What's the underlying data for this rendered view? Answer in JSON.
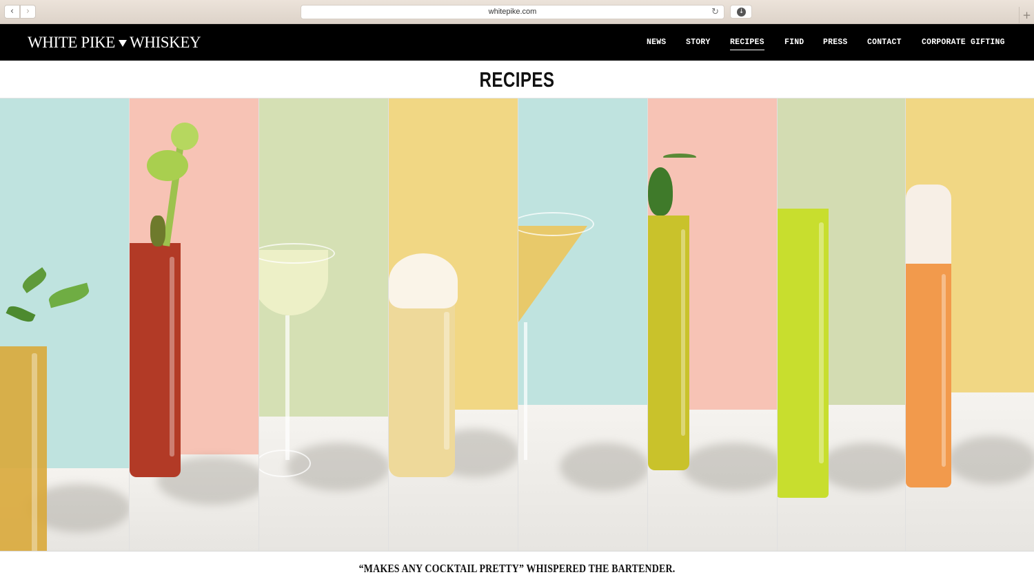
{
  "browser": {
    "url": "whitepike.com",
    "back_glyph": "‹",
    "forward_glyph": "›",
    "reload_glyph": "↻",
    "download_glyph": "↓",
    "newtab_glyph": "+"
  },
  "header": {
    "logo_left": "WHITE PIKE",
    "logo_right": "WHISKEY",
    "nav": [
      {
        "label": "NEWS",
        "active": false
      },
      {
        "label": "STORY",
        "active": false
      },
      {
        "label": "RECIPES",
        "active": true
      },
      {
        "label": "FIND",
        "active": false
      },
      {
        "label": "PRESS",
        "active": false
      },
      {
        "label": "CONTACT",
        "active": false
      },
      {
        "label": "CORPORATE GIFTING",
        "active": false
      }
    ]
  },
  "page": {
    "title": "RECIPES",
    "tagline": "“MAKES ANY COCKTAIL PRETTY” WHISPERED THE BARTENDER."
  },
  "gallery": {
    "panels": [
      {
        "name": "iced-tea-cocktail",
        "wall": "#bfe3df",
        "drink": "#d9a93a",
        "garnish": "mint"
      },
      {
        "name": "bloody-mary-cocktail",
        "wall": "#f7c3b5",
        "drink": "#b23a26",
        "garnish": "celery"
      },
      {
        "name": "coupe-cocktail",
        "wall": "#d5e0b4",
        "drink": "#eef0c8",
        "garnish": "none"
      },
      {
        "name": "cream-topped-cocktail",
        "wall": "#f1d784",
        "drink": "#eed99a",
        "garnish": "cream"
      },
      {
        "name": "martini-cocktail",
        "wall": "#bfe3df",
        "drink": "#e8c96a",
        "garnish": "none"
      },
      {
        "name": "jalapeno-cocktail",
        "wall": "#f7c3b5",
        "drink": "#c9c22b",
        "garnish": "pepper"
      },
      {
        "name": "green-highball-cocktail",
        "wall": "#d3dcb2",
        "drink": "#c8de2e",
        "garnish": "none"
      },
      {
        "name": "orange-foam-cocktail",
        "wall": "#f1d784",
        "drink": "#f29a4c",
        "garnish": "foam"
      }
    ]
  }
}
